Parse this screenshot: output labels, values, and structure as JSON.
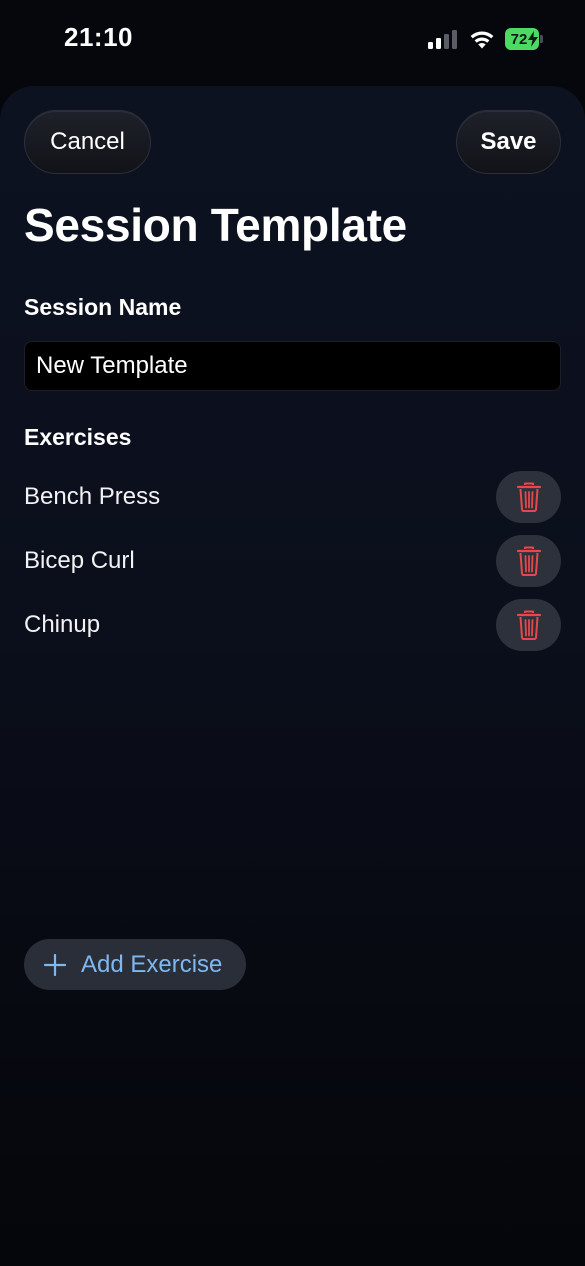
{
  "status_bar": {
    "time": "21:10",
    "battery_level": "72",
    "battery_color": "#4cd964"
  },
  "header": {
    "cancel_label": "Cancel",
    "save_label": "Save",
    "title": "Session Template"
  },
  "session_name": {
    "label": "Session Name",
    "value": "New Template"
  },
  "exercises": {
    "label": "Exercises",
    "items": [
      {
        "name": "Bench Press",
        "delete_icon": "trash-icon"
      },
      {
        "name": "Bicep Curl",
        "delete_icon": "trash-icon"
      },
      {
        "name": "Chinup",
        "delete_icon": "trash-icon"
      }
    ]
  },
  "add_exercise": {
    "label": "Add Exercise",
    "icon": "plus-icon",
    "color": "#7fb7f0"
  },
  "colors": {
    "delete_red": "#e5484d",
    "background": "#0b0f1c"
  }
}
